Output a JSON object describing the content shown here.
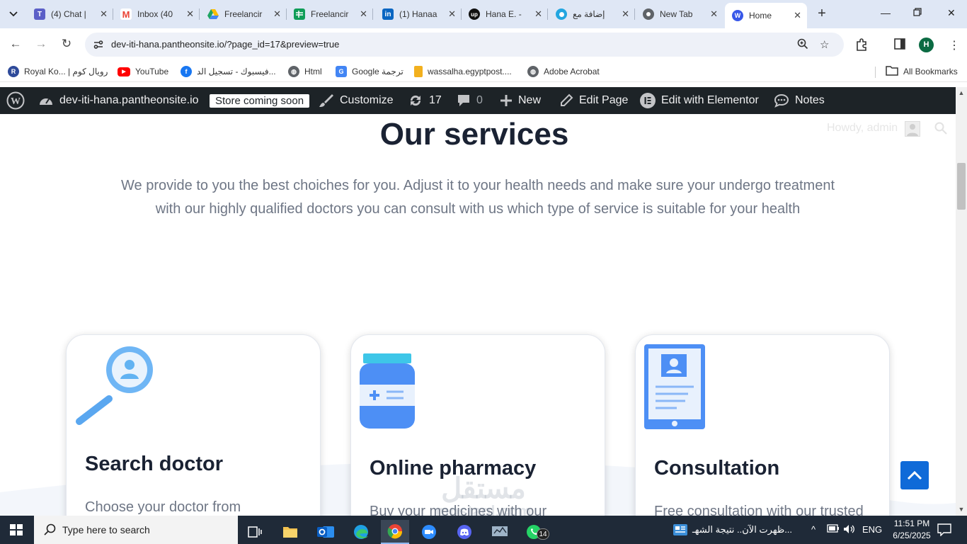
{
  "browser": {
    "tabs": [
      {
        "label": "(4) Chat |",
        "icon": "teams-icon",
        "color": "#5b5fc7"
      },
      {
        "label": "Inbox (40",
        "icon": "gmail-icon",
        "color": "#ea4335"
      },
      {
        "label": "Freelancir",
        "icon": "drive-icon",
        "color": "#1fa463"
      },
      {
        "label": "Freelancir",
        "icon": "sheets-icon",
        "color": "#0f9d58"
      },
      {
        "label": "(1) Hanaa",
        "icon": "linkedin-icon",
        "color": "#0a66c2"
      },
      {
        "label": "Hana E. -",
        "icon": "upwork-icon",
        "color": "#111111"
      },
      {
        "label": "إضافة مع",
        "icon": "circle-app-icon",
        "color": "#23a6e0"
      },
      {
        "label": "New Tab",
        "icon": "chrome-icon",
        "color": "#555555"
      },
      {
        "label": "Home",
        "icon": "wordpress-icon",
        "color": "#3858e9"
      }
    ],
    "url": "dev-iti-hana.pantheonsite.io/?page_id=17&preview=true",
    "profile_initial": "H",
    "bookmarks": [
      {
        "label": "Royal Ko... | رويال كوم",
        "icon": "royal-icon",
        "color": "#2e4a9a"
      },
      {
        "label": "YouTube",
        "icon": "youtube-icon",
        "color": "#ff0000"
      },
      {
        "label": "فيسبوك - تسجيل الد...",
        "icon": "facebook-icon",
        "color": "#1877f2"
      },
      {
        "label": "Html",
        "icon": "globe-icon",
        "color": "#555555"
      },
      {
        "label": "Google ترجمة",
        "icon": "google-translate-icon",
        "color": "#4285f4"
      },
      {
        "label": "wassalha.egyptpost....",
        "icon": "wassalha-icon",
        "color": "#f2b01e"
      },
      {
        "label": "Adobe Acrobat",
        "icon": "globe-icon",
        "color": "#555555"
      }
    ],
    "all_bookmarks": "All Bookmarks"
  },
  "wpbar": {
    "site": "dev-iti-hana.pantheonsite.io",
    "store_badge": "Store coming soon",
    "customize": "Customize",
    "updates": "17",
    "comments": "0",
    "new": "New",
    "edit_page": "Edit Page",
    "elementor": "Edit with Elementor",
    "notes": "Notes",
    "howdy": "Howdy, admin"
  },
  "page": {
    "heading": "Our services",
    "intro_line1": "We provide to you the best choiches for you. Adjust it to your health needs and make sure your undergo treatment",
    "intro_line2": "with our highly qualified doctors you can consult with us which type of service is suitable for your health",
    "cards": [
      {
        "title": "Search doctor",
        "text": "Choose your doctor from",
        "icon": "magnifier-doctor-icon"
      },
      {
        "title": "Online pharmacy",
        "text": "Buy your medicines with our",
        "icon": "medicine-bottle-icon"
      },
      {
        "title": "Consultation",
        "text": "Free consultation with our trusted",
        "icon": "tablet-profile-icon"
      }
    ],
    "watermark_top": "مستقل",
    "watermark_bottom": "mostaql.com",
    "accent": "#0f6ad8"
  },
  "taskbar": {
    "search_placeholder": "Type here to search",
    "whatsapp_badge": "14",
    "news": "ظهرت الآن.. نتيجة الشهـ...",
    "lang": "ENG",
    "time": "11:51 PM",
    "date": "6/25/2025"
  }
}
